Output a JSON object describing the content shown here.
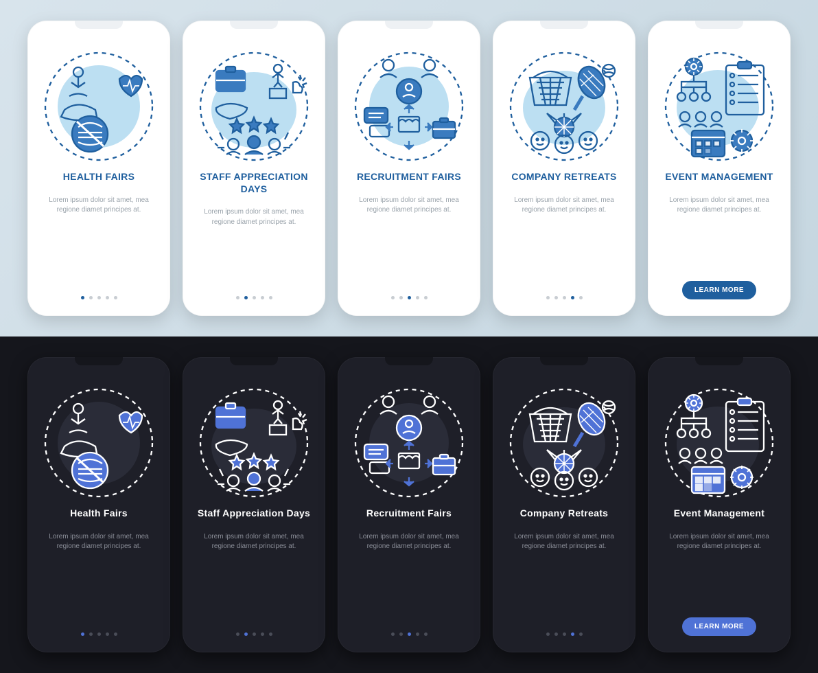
{
  "body_text": "Lorem ipsum dolor sit amet, mea regione diamet principes at.",
  "button_label": "LEARN MORE",
  "colors": {
    "light_accent": "#1f5f9e",
    "light_text_muted": "#9aa3ab",
    "dark_accent": "#4f72d6",
    "dark_bg": "#15161c",
    "dark_card": "#1e1f28"
  },
  "light": {
    "cards": [
      {
        "title": "HEALTH FAIRS",
        "dots": 5,
        "active_dot": 0,
        "icon": "health-fairs-icon"
      },
      {
        "title": "STAFF APPRECIATION DAYS",
        "dots": 5,
        "active_dot": 1,
        "icon": "staff-appreciation-icon"
      },
      {
        "title": "RECRUITMENT FAIRS",
        "dots": 5,
        "active_dot": 2,
        "icon": "recruitment-fairs-icon"
      },
      {
        "title": "COMPANY RETREATS",
        "dots": 5,
        "active_dot": 3,
        "icon": "company-retreats-icon"
      },
      {
        "title": "EVENT MANAGEMENT",
        "dots": 5,
        "active_dot": 4,
        "icon": "event-management-icon",
        "has_button": true
      }
    ]
  },
  "dark": {
    "cards": [
      {
        "title": "Health Fairs",
        "dots": 5,
        "active_dot": 0,
        "icon": "health-fairs-icon"
      },
      {
        "title": "Staff Appreciation Days",
        "dots": 5,
        "active_dot": 1,
        "icon": "staff-appreciation-icon"
      },
      {
        "title": "Recruitment Fairs",
        "dots": 5,
        "active_dot": 2,
        "icon": "recruitment-fairs-icon"
      },
      {
        "title": "Company Retreats",
        "dots": 5,
        "active_dot": 3,
        "icon": "company-retreats-icon"
      },
      {
        "title": "Event Management",
        "dots": 5,
        "active_dot": 4,
        "icon": "event-management-icon",
        "has_button": true
      }
    ]
  }
}
